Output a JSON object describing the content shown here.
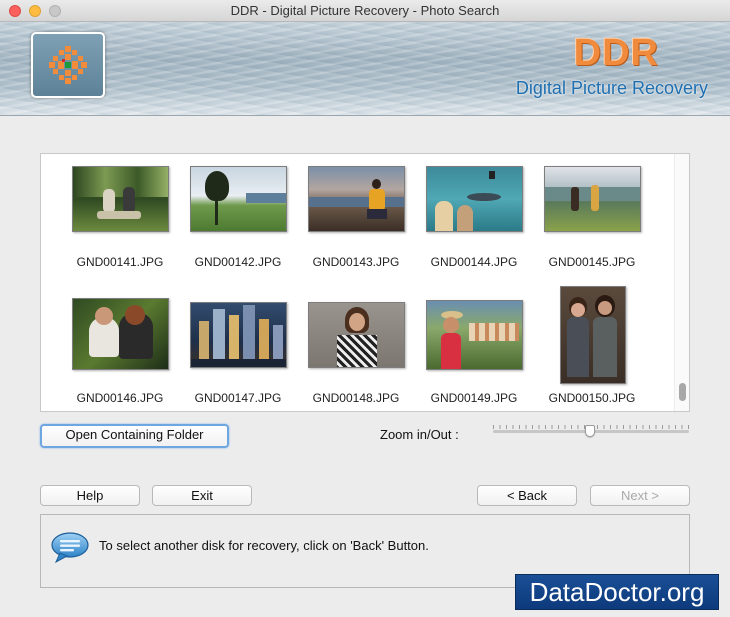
{
  "window": {
    "title": "DDR - Digital Picture Recovery - Photo Search"
  },
  "banner": {
    "brand": "DDR",
    "subtitle": "Digital Picture Recovery",
    "logo_icon": "ddr-logo-icon"
  },
  "gallery": {
    "items": [
      {
        "file": "GND00141.JPG"
      },
      {
        "file": "GND00142.JPG"
      },
      {
        "file": "GND00143.JPG"
      },
      {
        "file": "GND00144.JPG"
      },
      {
        "file": "GND00145.JPG"
      },
      {
        "file": "GND00146.JPG"
      },
      {
        "file": "GND00147.JPG"
      },
      {
        "file": "GND00148.JPG"
      },
      {
        "file": "GND00149.JPG"
      },
      {
        "file": "GND00150.JPG"
      }
    ]
  },
  "controls": {
    "open_folder_label": "Open Containing Folder",
    "zoom_label": "Zoom in/Out :",
    "help_label": "Help",
    "exit_label": "Exit",
    "back_label": "< Back",
    "next_label": "Next >"
  },
  "info": {
    "message": "To select another disk for recovery, click on 'Back' Button.",
    "icon": "speech-bubble-icon"
  },
  "watermark": {
    "text": "DataDoctor.org"
  },
  "colors": {
    "brand_orange": "#f08a3c",
    "brand_blue": "#1f6fb0",
    "watermark_blue": "#1a4f96"
  }
}
